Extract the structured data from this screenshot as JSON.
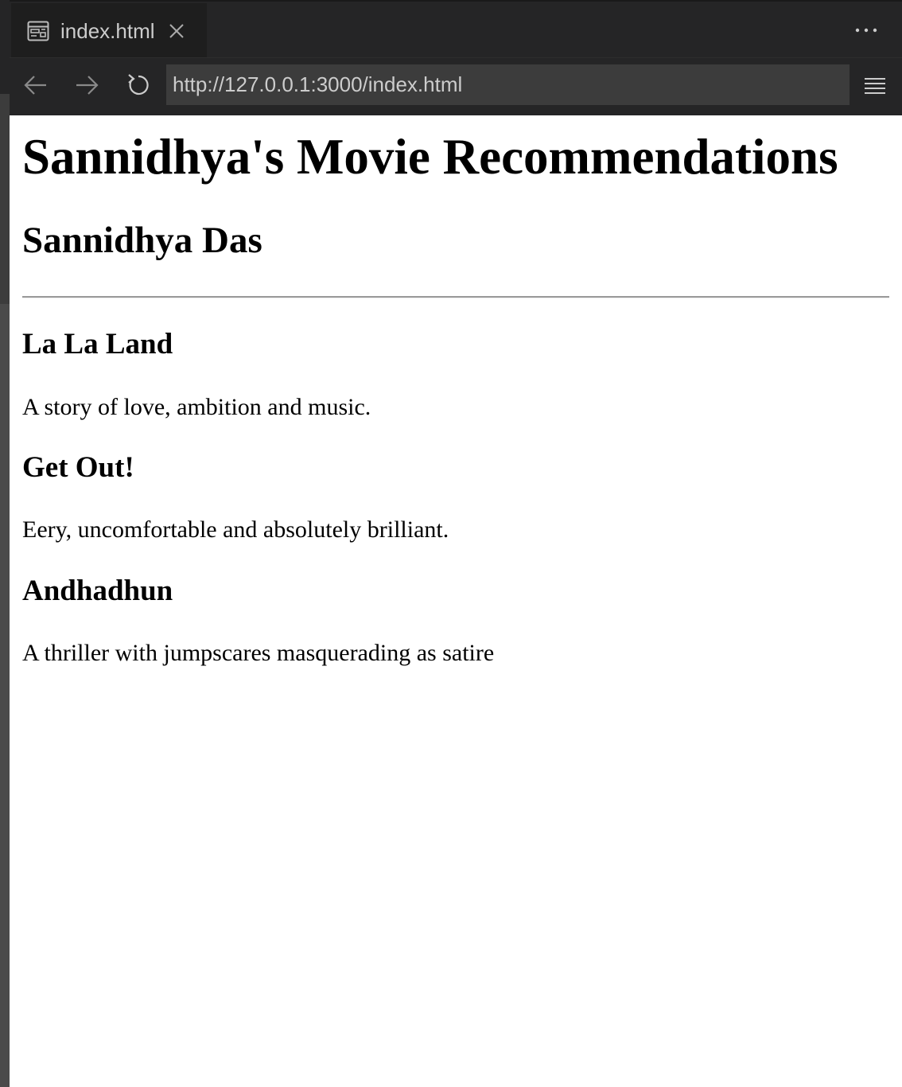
{
  "browser": {
    "tab": {
      "icon": "preview-icon",
      "label": "index.html",
      "close_icon": "close-icon"
    },
    "more_icon": "more-horizontal-icon",
    "nav": {
      "back_icon": "arrow-left-icon",
      "forward_icon": "arrow-right-icon",
      "reload_icon": "reload-icon"
    },
    "url": "http://127.0.0.1:3000/index.html",
    "menu_icon": "hamburger-menu-icon"
  },
  "page": {
    "title": "Sannidhya's Movie Recommendations",
    "author": "Sannidhya Das",
    "movies": [
      {
        "title": "La La Land",
        "description": "A story of love, ambition and music."
      },
      {
        "title": "Get Out!",
        "description": "Eery, uncomfortable and absolutely brilliant."
      },
      {
        "title": "Andhadhun",
        "description": "A thriller with jumpscares masquerading as satire"
      }
    ]
  },
  "colors": {
    "chrome_bg": "#252526",
    "active_tab_bg": "#1e1e1e",
    "url_bar_bg": "#3c3c3c",
    "chrome_text": "#cccccc",
    "page_bg": "#ffffff",
    "page_text": "#000000"
  }
}
